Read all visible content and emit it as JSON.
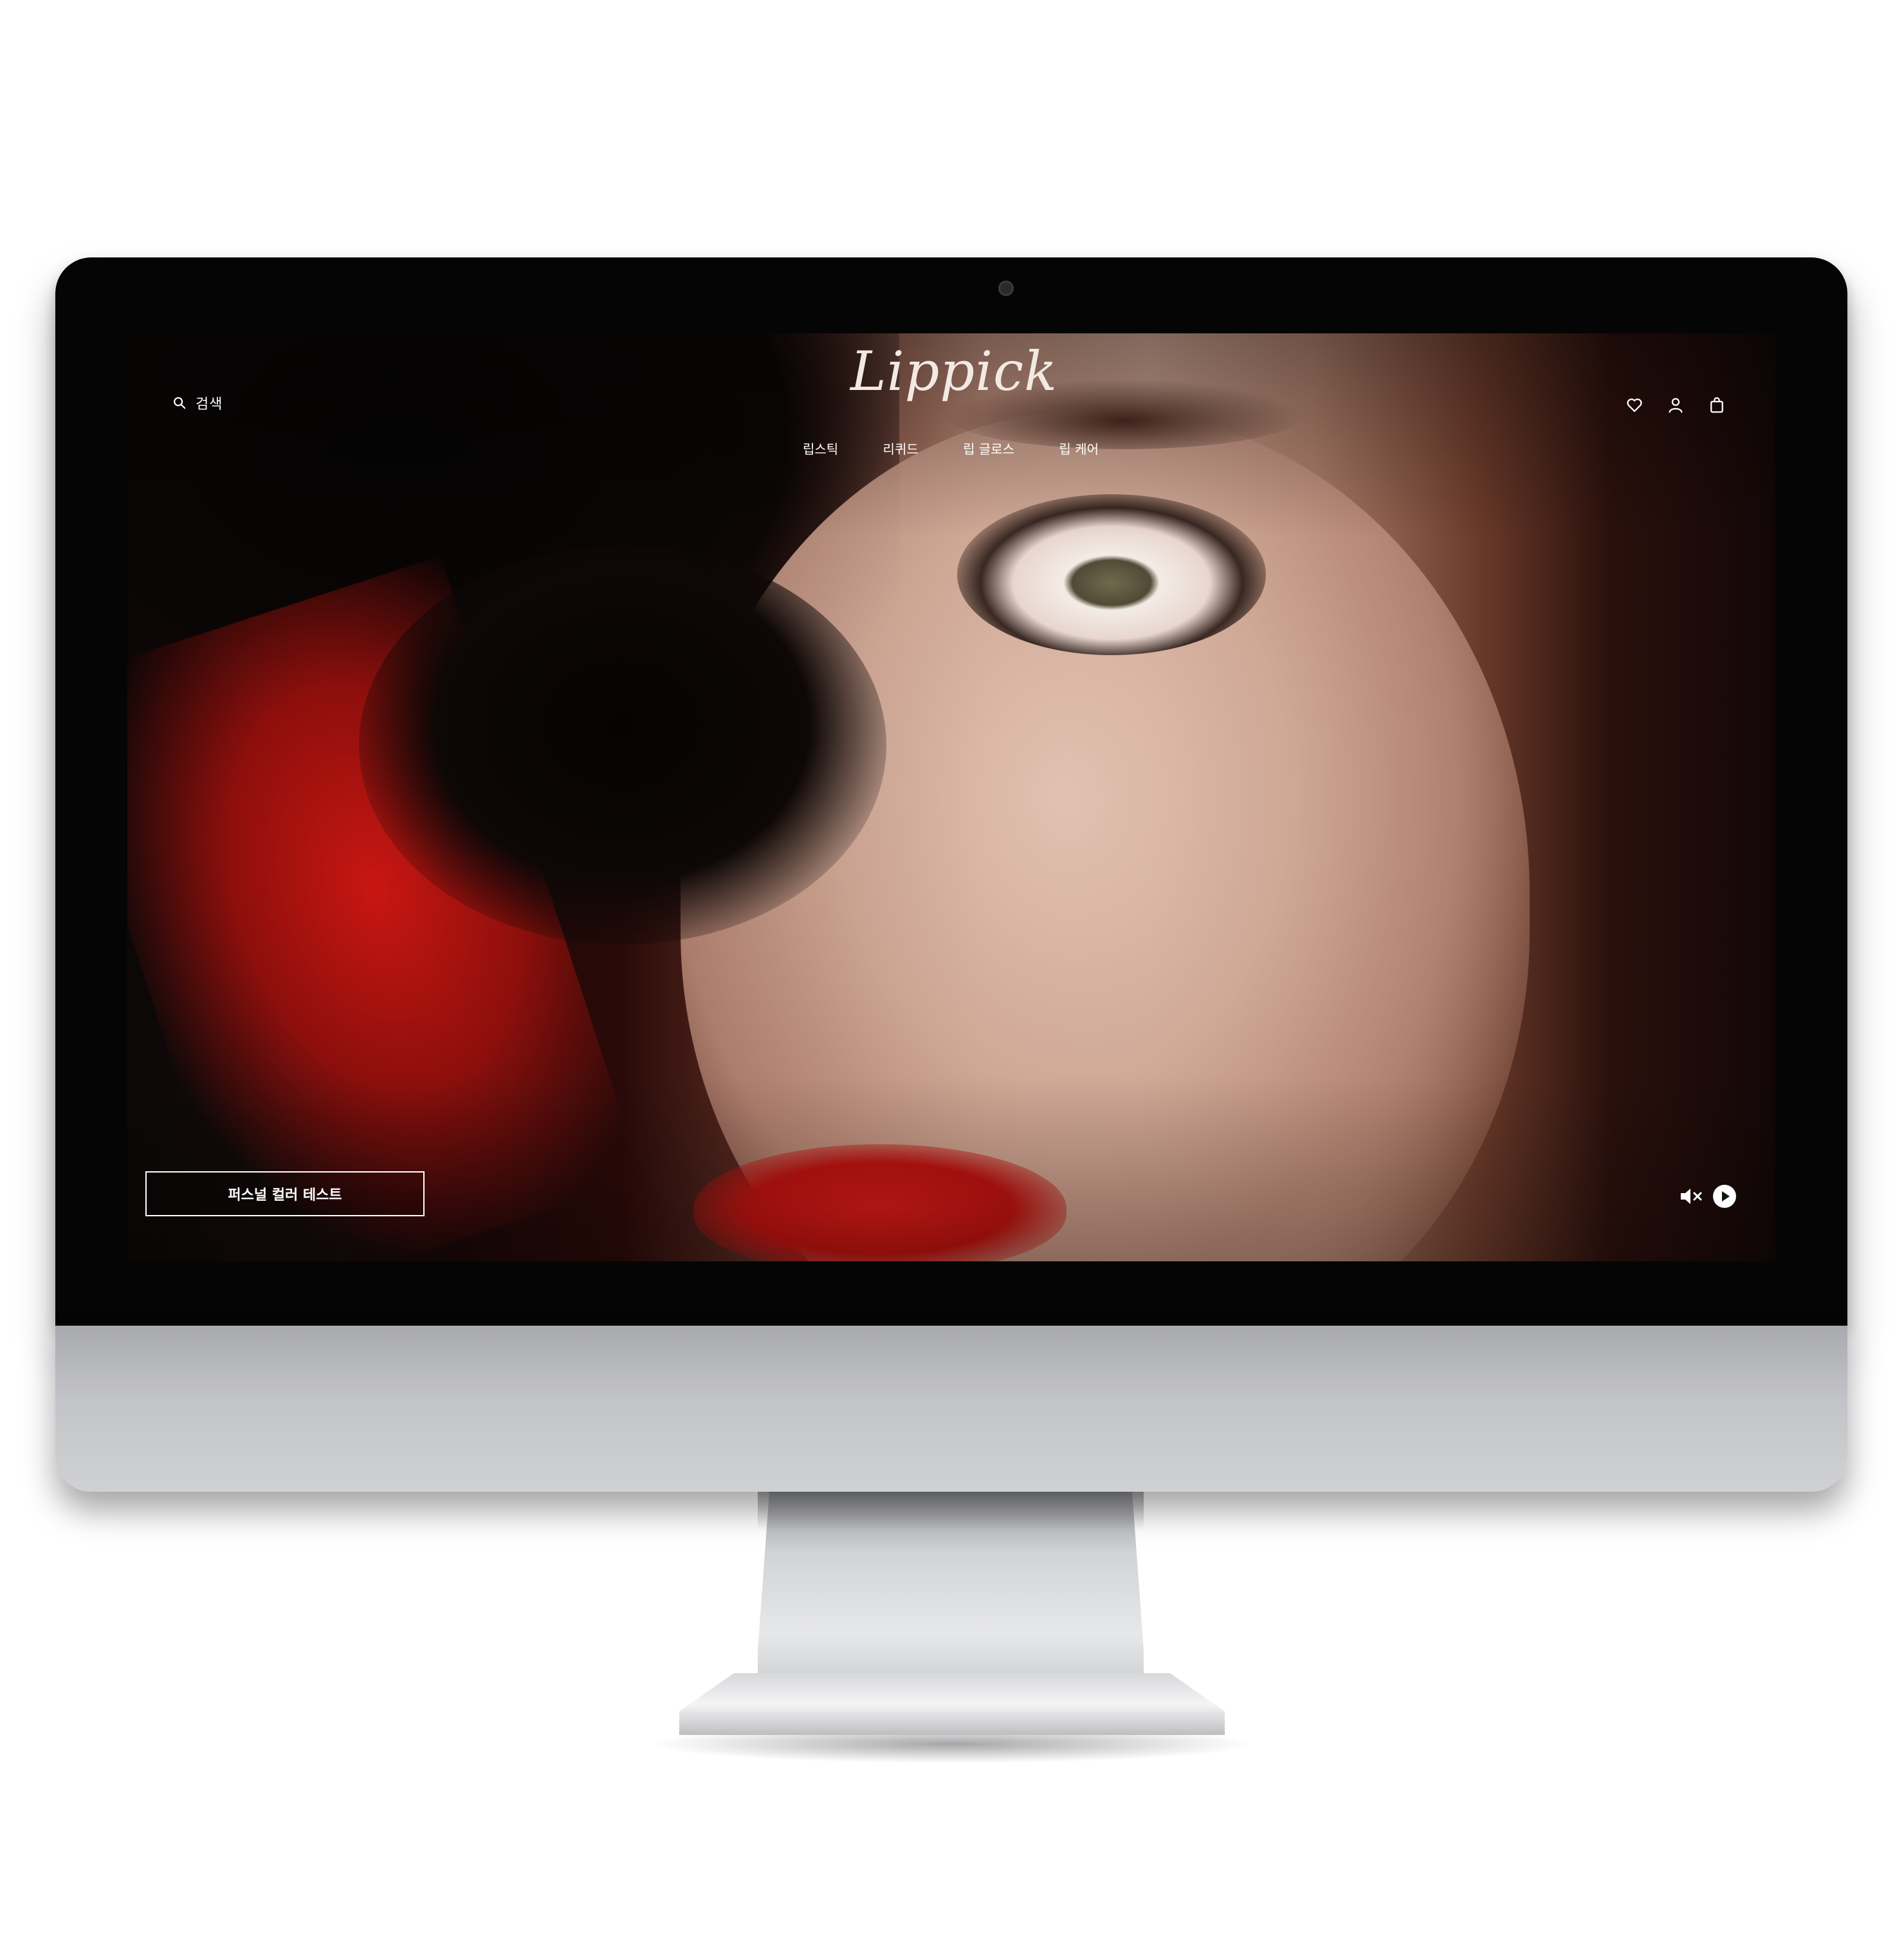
{
  "site": {
    "brand": "Lippick",
    "search_label": "검색",
    "nav": [
      {
        "label": "립스틱"
      },
      {
        "label": "리퀴드"
      },
      {
        "label": "립 글로스"
      },
      {
        "label": "립 케어"
      }
    ],
    "header_icons": [
      "heart-icon",
      "user-icon",
      "shopping-bag-icon"
    ],
    "cta_label": "퍼스널 컬러 테스트",
    "media_icons": [
      "mute-icon",
      "play-icon"
    ]
  },
  "colors": {
    "text": "#ffffff",
    "logo": "#f3e9e4",
    "lip_red": "#c91612",
    "screen_bg": "#0a0707"
  }
}
